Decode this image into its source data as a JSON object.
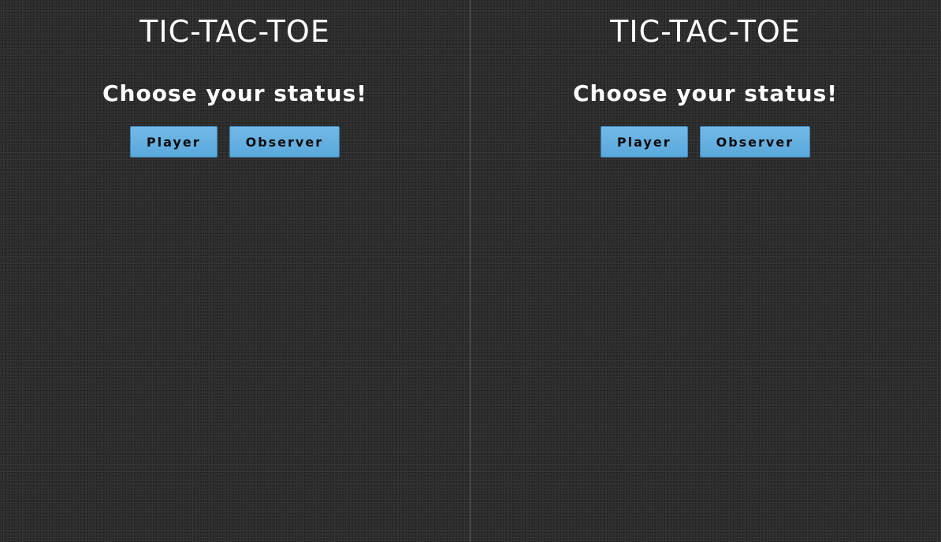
{
  "panes": [
    {
      "title": "TIC-TAC-TOE",
      "prompt": "Choose your status!",
      "buttons": {
        "player": "Player",
        "observer": "Observer"
      }
    },
    {
      "title": "TIC-TAC-TOE",
      "prompt": "Choose your status!",
      "buttons": {
        "player": "Player",
        "observer": "Observer"
      }
    }
  ],
  "colors": {
    "background": "#2b2b2b",
    "button": "#63afe0",
    "divider": "#5f5f5f",
    "text": "#ffffff"
  }
}
